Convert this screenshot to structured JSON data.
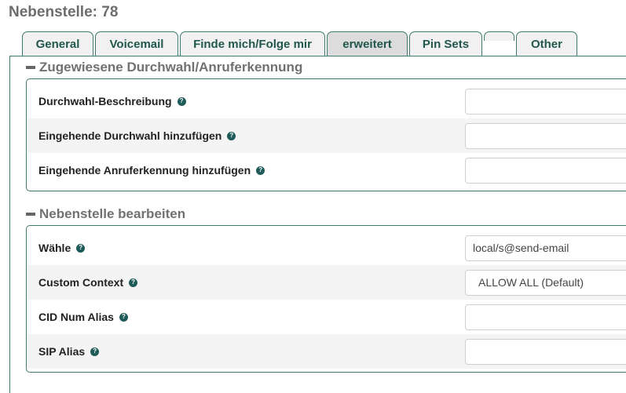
{
  "page": {
    "title": "Nebenstelle: 78"
  },
  "tabs": [
    {
      "label": "General"
    },
    {
      "label": "Voicemail"
    },
    {
      "label": "Finde mich/Folge mir"
    },
    {
      "label": "erweitert",
      "active": true
    },
    {
      "label": "Pin Sets"
    },
    {
      "label": ""
    },
    {
      "label": "Other"
    }
  ],
  "sections": [
    {
      "title": "Zugewiesene Durchwahl/Anruferkennung",
      "fields": [
        {
          "label": "Durchwahl-Beschreibung",
          "value": ""
        },
        {
          "label": "Eingehende Durchwahl hinzufügen",
          "value": ""
        },
        {
          "label": "Eingehende Anruferkennung hinzufügen",
          "value": ""
        }
      ]
    },
    {
      "title": "Nebenstelle bearbeiten",
      "fields": [
        {
          "label": "Wähle",
          "value": "local/s@send-email"
        },
        {
          "label": "Custom Context",
          "value": "ALLOW ALL (Default)"
        },
        {
          "label": "CID Num Alias",
          "value": ""
        },
        {
          "label": "SIP Alias",
          "value": ""
        }
      ]
    }
  ],
  "icons": {
    "help": "help-icon",
    "collapse": "minus-icon"
  },
  "colors": {
    "accent": "#3f7a6e",
    "tab_text": "#22574d",
    "help_icon": "#1e5a58"
  },
  "help_glyph": "?"
}
